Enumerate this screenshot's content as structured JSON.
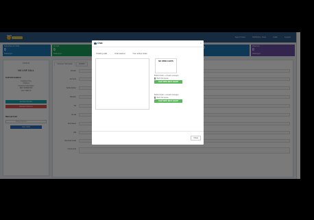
{
  "header": {
    "nav": [
      "Agent View",
      "SIM/Entry View",
      "Calls",
      "Logout"
    ],
    "logo_text": "SAVI"
  },
  "cards": [
    {
      "title": "Subscribers On Hold",
      "value": "0",
      "footer": "Total Avg 0",
      "color": "#1f78b4"
    },
    {
      "title": "On Call",
      "value": "0",
      "footer": "Total Avg 0",
      "color": "#1a9e5c"
    },
    {
      "title": "",
      "value": "0",
      "footer": "",
      "color": "#1f78b4"
    },
    {
      "title": "Wrap-Ups",
      "value": "0",
      "footer": "Total Avg 0",
      "color": "#6c4ea1"
    }
  ],
  "left": {
    "title": "CUSTO",
    "status": "NO LIVE CALL",
    "call_info_title": "Call Information",
    "info_lines": [
      "Customer Tiny",
      "Channel",
      "Customer Information",
      "REF ORDER ID#",
      "CRU TIME 00"
    ],
    "buttons": [
      "Get Next Number",
      "Release Customer"
    ],
    "manual_title": "Manual Call",
    "phone_placeholder": "Phone Number",
    "dial_button": "DIAL NOW"
  },
  "main": {
    "tabs": [
      "Customer Information",
      "SCRIPT"
    ],
    "labels": [
      "Vendor",
      "Account",
      "Subscription",
      "Reason",
      "Tel",
      "Email",
      "Sub Name",
      "Bill",
      "Serviced Code",
      "Comments"
    ]
  },
  "modal": {
    "title": "Chat",
    "tabs": [
      "Chatting with",
      "Chat started",
      "Your active chats"
    ],
    "open_chats": "NO OPEN CHATS",
    "group1": {
      "title": "Bottled chats + unread messages",
      "check": "Web chat queue",
      "button": "CHAT WITH NEXT AGENT"
    },
    "group2": {
      "title": "Bottled chats + unread messages",
      "check": "Web chat queue",
      "button": "CHAT WITH NEXT AGENT"
    },
    "close_button": "Close"
  }
}
